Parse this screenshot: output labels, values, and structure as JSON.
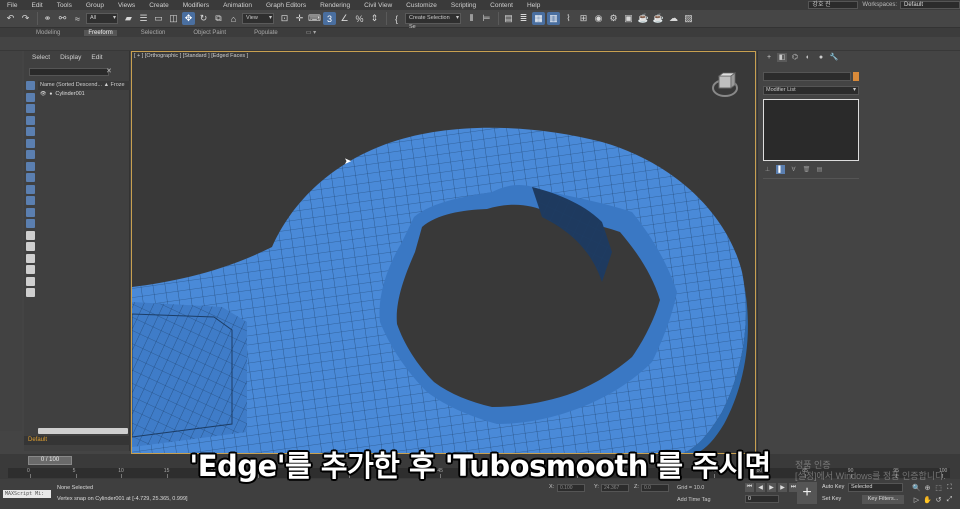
{
  "menu": {
    "items": [
      "File",
      "Edit",
      "Tools",
      "Group",
      "Views",
      "Create",
      "Modifiers",
      "Animation",
      "Graph Editors",
      "Rendering",
      "Civil View",
      "Customize",
      "Scripting",
      "Content",
      "Help"
    ],
    "user": "강호 진",
    "workspace_label": "Workspaces:",
    "workspace_value": "Default"
  },
  "toolbar": {
    "filter_value": "All",
    "reference_coord": "View",
    "selection_set": "Create Selection Se"
  },
  "ribbon": {
    "tabs": [
      "Modeling",
      "Freeform",
      "Selection",
      "Object Paint",
      "Populate"
    ],
    "active_tab": "Freeform"
  },
  "scene_explorer": {
    "tabs": [
      "Select",
      "Display",
      "Edit"
    ],
    "column_header": "Name (Sorted Descend... ▲  Froze",
    "rows": [
      "Cylinder001"
    ],
    "layer": "Default"
  },
  "viewport": {
    "label": "[ + ] [Orthographic ] [Standard ] [Edged Faces ]",
    "mesh_color": "#4a8ad8",
    "wire_color": "#1c3d66"
  },
  "command_panel": {
    "modifier_list": "Modifier List"
  },
  "timeline": {
    "frame_display": "0 / 100",
    "ticks": [
      "0",
      "5",
      "10",
      "15",
      "20",
      "25",
      "30",
      "35",
      "40",
      "45",
      "50",
      "55",
      "60",
      "65",
      "70",
      "75",
      "80",
      "85",
      "90",
      "95",
      "100"
    ]
  },
  "status": {
    "maxscript": "MAXScript Mi:",
    "selection": "None Selected",
    "prompt": "Vertex snap on Cylinder001 at [-4.729, 25.365, 0.999]",
    "x_label": "X:",
    "x_value": "0.100",
    "y_label": "Y:",
    "y_value": "24.367",
    "z_label": "Z:",
    "z_value": "0.0",
    "grid": "Grid = 10.0",
    "add_time_tag": "Add Time Tag",
    "frame_value": "0",
    "auto_key": "Auto Key",
    "set_key": "Set Key",
    "selected": "Selected",
    "key_filters": "Key Filters..."
  },
  "subtitle": "'Edge'를 추가한 후  'Tubosmooth'를 주시면",
  "watermark": [
    "정품 인증",
    "[설정]에서 Windows를 정품 인증합니다."
  ]
}
